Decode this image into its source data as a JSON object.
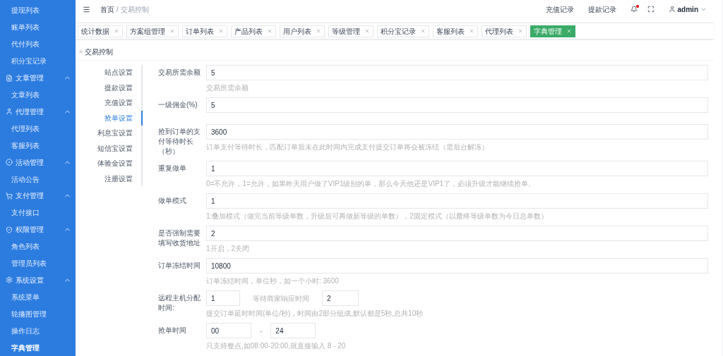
{
  "sidebar": {
    "items": [
      {
        "kind": "item",
        "label": "提现列表",
        "selected": false
      },
      {
        "kind": "item",
        "label": "账单列表",
        "selected": false
      },
      {
        "kind": "item",
        "label": "代付列表",
        "selected": false
      },
      {
        "kind": "item",
        "label": "积分宝记录",
        "selected": false
      },
      {
        "kind": "group",
        "label": "文章管理",
        "expanded": true
      },
      {
        "kind": "item",
        "label": "文章列表",
        "selected": false
      },
      {
        "kind": "group",
        "label": "代理管理",
        "expanded": true
      },
      {
        "kind": "item",
        "label": "代理列表",
        "selected": false
      },
      {
        "kind": "item",
        "label": "客服列表",
        "selected": false
      },
      {
        "kind": "group",
        "label": "活动管理",
        "expanded": true
      },
      {
        "kind": "item",
        "label": "活动公告",
        "selected": false
      },
      {
        "kind": "group",
        "label": "支付管理",
        "expanded": true
      },
      {
        "kind": "item",
        "label": "支付接口",
        "selected": false
      },
      {
        "kind": "group",
        "label": "权限管理",
        "expanded": true
      },
      {
        "kind": "item",
        "label": "角色列表",
        "selected": false
      },
      {
        "kind": "item",
        "label": "管理员列表",
        "selected": false
      },
      {
        "kind": "group",
        "label": "系统设置",
        "expanded": true
      },
      {
        "kind": "item",
        "label": "系统菜单",
        "selected": false
      },
      {
        "kind": "item",
        "label": "轮播图管理",
        "selected": false
      },
      {
        "kind": "item",
        "label": "操作日志",
        "selected": false
      },
      {
        "kind": "item",
        "label": "字典管理",
        "selected": true
      }
    ]
  },
  "header": {
    "breadcrumb": {
      "home": "首页",
      "separator": "/",
      "current": "交易控制"
    },
    "links": [
      "充值记录",
      "提款记录"
    ],
    "notification": true,
    "user": "admin"
  },
  "tabs": [
    {
      "label": "统计数据",
      "selected": false
    },
    {
      "label": "方案组管理",
      "selected": false
    },
    {
      "label": "订单列表",
      "selected": false
    },
    {
      "label": "产品列表",
      "selected": false
    },
    {
      "label": "用户列表",
      "selected": false
    },
    {
      "label": "等级管理",
      "selected": false
    },
    {
      "label": "积分宝记录",
      "selected": false
    },
    {
      "label": "客服列表",
      "selected": false
    },
    {
      "label": "代理列表",
      "selected": false
    },
    {
      "label": "字典管理",
      "selected": true
    }
  ],
  "page_title": {
    "marker": "»",
    "text": "交易控制"
  },
  "settings_nav": [
    {
      "label": "站点设置",
      "selected": false
    },
    {
      "label": "提款设置",
      "selected": false
    },
    {
      "label": "充值设置",
      "selected": false
    },
    {
      "label": "抢单设置",
      "selected": true
    },
    {
      "label": "利息宝设置",
      "selected": false
    },
    {
      "label": "短信宝设置",
      "selected": false
    },
    {
      "label": "体验金设置",
      "selected": false
    },
    {
      "label": "注册设置",
      "selected": false
    }
  ],
  "form": [
    {
      "kind": "single",
      "label": "交易所需余额",
      "value": "5",
      "hint": "交易所需余额"
    },
    {
      "kind": "single",
      "label": "一级佣金(%)",
      "value": "5"
    },
    {
      "kind": "single",
      "label": "抢到订单的支付等待时长（秒）",
      "value": "3600",
      "hint": "订单支付等待时长，匹配订单后未在此时间内完成支付提交订单将会被冻结（需后台解冻）"
    },
    {
      "kind": "single",
      "label": "重复做单",
      "value": "1",
      "hint": "0=不允许，1=允许，如果昨天用户做了VIP1级别的单，那么今天他还是VIP1了，必须升级才能继续抢单。"
    },
    {
      "kind": "single",
      "label": "做单模式",
      "value": "1",
      "hint": "1:叠加模式（做完当前等级单数，升级后可再做新等级的单数），2固定模式（以最终等级单数为今日总单数）"
    },
    {
      "kind": "single",
      "label": "是否强制需要填写收货地址",
      "value": "2",
      "hint": "1开启，2关闭"
    },
    {
      "kind": "single",
      "label": "订单冻结时间",
      "value": "10800",
      "hint": "订单冻结时间，单位秒，如一个小时: 3600"
    },
    {
      "kind": "pair",
      "label": "远程主机分配时间:",
      "value": "1",
      "label2": "等待商家响应时间",
      "value2": "2",
      "hint": "提交订单延时时间(单位/秒)，时间由2部分组成,默认都是5秒,总共10秒"
    },
    {
      "kind": "range",
      "label": "抢单时间",
      "value": "00",
      "separator": "-",
      "value2": "24",
      "hint": "只支持整点,如08:00-20:00,就直接输入 8 - 20"
    }
  ]
}
